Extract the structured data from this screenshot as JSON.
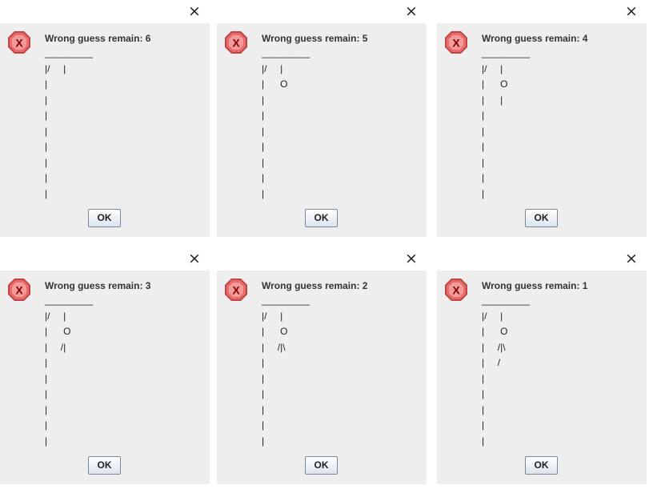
{
  "dialogs": [
    {
      "message": "Wrong guess remain: 6",
      "ok_label": "OK",
      "close_glyph": "×",
      "icon": "error-icon",
      "drawing": [
        "_________",
        "|/     |",
        "|",
        "|",
        "|",
        "|",
        "|",
        "|",
        "|",
        "|"
      ]
    },
    {
      "message": "Wrong guess remain: 5",
      "ok_label": "OK",
      "close_glyph": "×",
      "icon": "error-icon",
      "drawing": [
        "_________",
        "|/     |",
        "|      O",
        "|",
        "|",
        "|",
        "|",
        "|",
        "|",
        "|"
      ]
    },
    {
      "message": "Wrong guess remain: 4",
      "ok_label": "OK",
      "close_glyph": "×",
      "icon": "error-icon",
      "drawing": [
        "_________",
        "|/     |",
        "|      O",
        "|      |",
        "|",
        "|",
        "|",
        "|",
        "|",
        "|"
      ]
    },
    {
      "message": "Wrong guess remain: 3",
      "ok_label": "OK",
      "close_glyph": "×",
      "icon": "error-icon",
      "drawing": [
        "_________",
        "|/     |",
        "|      O",
        "|     /|",
        "|",
        "|",
        "|",
        "|",
        "|",
        "|"
      ]
    },
    {
      "message": "Wrong guess remain: 2",
      "ok_label": "OK",
      "close_glyph": "×",
      "icon": "error-icon",
      "drawing": [
        "_________",
        "|/     |",
        "|      O",
        "|     /|\\",
        "|",
        "|",
        "|",
        "|",
        "|",
        "|"
      ]
    },
    {
      "message": "Wrong guess remain: 1",
      "ok_label": "OK",
      "close_glyph": "×",
      "icon": "error-icon",
      "drawing": [
        "_________",
        "|/     |",
        "|      O",
        "|     /|\\",
        "|     /",
        "|",
        "|",
        "|",
        "|",
        "|"
      ]
    }
  ],
  "colors": {
    "error_icon_fill": "#e05a5a",
    "error_icon_glyph": "#8b0000",
    "dialog_background": "#eeeeee"
  },
  "error_icon_glyph": "X"
}
